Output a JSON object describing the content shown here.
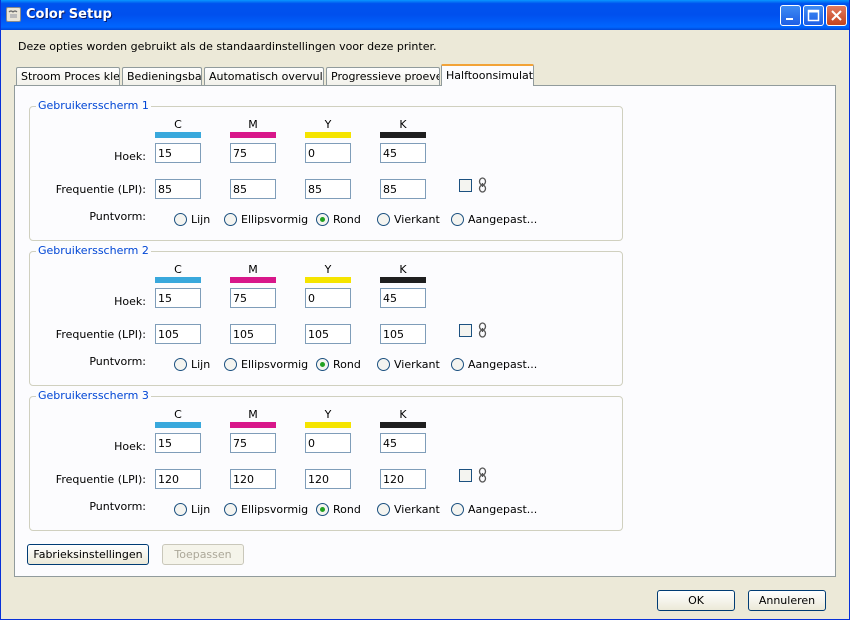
{
  "window": {
    "title": "Color Setup"
  },
  "description": "Deze opties worden gebruikt als de standaardinstellingen voor deze printer.",
  "tabs": [
    {
      "label": "Stroom Proces kleur"
    },
    {
      "label": "Bedieningsbalk"
    },
    {
      "label": "Automatisch overvullen"
    },
    {
      "label": "Progressieve proeven"
    },
    {
      "label": "Halftoonsimulatie",
      "active": true
    }
  ],
  "colors": {
    "C": "#39a8dc",
    "M": "#d8178a",
    "Y": "#f5e400",
    "K": "#1f1f1f",
    "accent": "#0046d5"
  },
  "row_labels": {
    "angle": "Hoek:",
    "frequency": "Frequentie (LPI):",
    "dot_shape": "Puntvorm:"
  },
  "screens": [
    {
      "title": "Gebruikersscherm 1",
      "channels": [
        "C",
        "M",
        "Y",
        "K"
      ],
      "angles": [
        "15",
        "75",
        "0",
        "45"
      ],
      "frequencies": [
        "85",
        "85",
        "85",
        "85"
      ],
      "link_checked": false,
      "shapes": [
        "Lijn",
        "Ellipsvormig",
        "Rond",
        "Vierkant",
        "Aangepast..."
      ],
      "selected_shape": "Rond"
    },
    {
      "title": "Gebruikersscherm 2",
      "channels": [
        "C",
        "M",
        "Y",
        "K"
      ],
      "angles": [
        "15",
        "75",
        "0",
        "45"
      ],
      "frequencies": [
        "105",
        "105",
        "105",
        "105"
      ],
      "link_checked": false,
      "shapes": [
        "Lijn",
        "Ellipsvormig",
        "Rond",
        "Vierkant",
        "Aangepast..."
      ],
      "selected_shape": "Rond"
    },
    {
      "title": "Gebruikersscherm 3",
      "channels": [
        "C",
        "M",
        "Y",
        "K"
      ],
      "angles": [
        "15",
        "75",
        "0",
        "45"
      ],
      "frequencies": [
        "120",
        "120",
        "120",
        "120"
      ],
      "link_checked": false,
      "shapes": [
        "Lijn",
        "Ellipsvormig",
        "Rond",
        "Vierkant",
        "Aangepast..."
      ],
      "selected_shape": "Rond"
    }
  ],
  "buttons": {
    "factory": "Fabrieksinstellingen",
    "apply": "Toepassen",
    "ok": "OK",
    "cancel": "Annuleren"
  }
}
